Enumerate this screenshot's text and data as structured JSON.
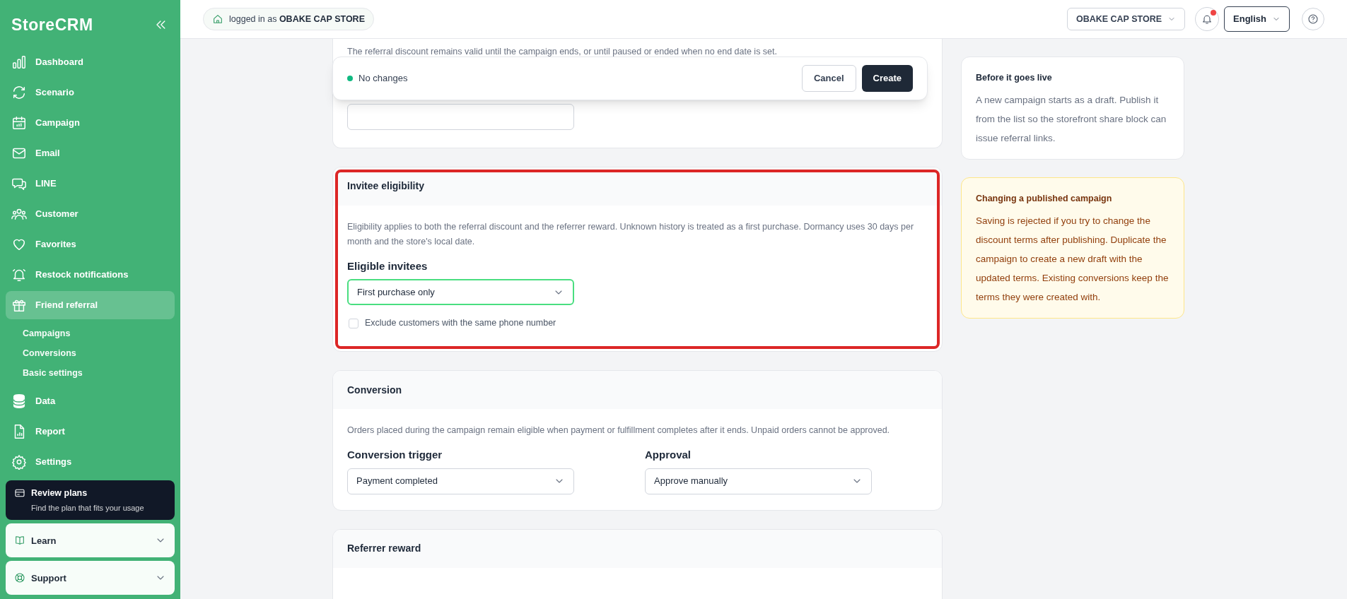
{
  "sidebar": {
    "brand": "StoreCRM",
    "items": [
      {
        "label": "Dashboard",
        "selected": false
      },
      {
        "label": "Scenario",
        "selected": false
      },
      {
        "label": "Campaign",
        "selected": false
      },
      {
        "label": "Email",
        "selected": false
      },
      {
        "label": "LINE",
        "selected": false
      },
      {
        "label": "Customer",
        "selected": false
      },
      {
        "label": "Favorites",
        "selected": false
      },
      {
        "label": "Restock notifications",
        "selected": false
      },
      {
        "label": "Friend referral",
        "selected": true,
        "children": [
          {
            "label": "Campaigns"
          },
          {
            "label": "Conversions"
          },
          {
            "label": "Basic settings"
          }
        ]
      },
      {
        "label": "Data",
        "selected": false
      },
      {
        "label": "Report",
        "selected": false
      },
      {
        "label": "Settings",
        "selected": false
      }
    ],
    "plan_card": {
      "title": "Review plans",
      "subtitle": "Find the plan that fits your usage"
    },
    "panels": [
      {
        "label": "Learn"
      },
      {
        "label": "Support"
      }
    ]
  },
  "topbar": {
    "login_prefix": "logged in as",
    "store_name": "OBAKE CAP STORE",
    "store_select": "OBAKE CAP STORE",
    "notification_unread": true,
    "language": "English"
  },
  "save_bar": {
    "status": "No changes",
    "buttons": [
      {
        "label": "Cancel",
        "kind": "secondary"
      },
      {
        "label": "Create",
        "kind": "primary"
      }
    ]
  },
  "main": {
    "top_card": {
      "note": "The referral discount remains valid until the campaign ends, or until paused or ended when no end date is set."
    },
    "sections": [
      {
        "title": "Invitee eligibility",
        "highlighted": true,
        "description": "Eligibility applies to both the referral discount and the referrer reward. Unknown history is treated as a first purchase. Dormancy uses 30 days per month and the store's local date.",
        "fields": [
          {
            "label": "Eligible invitees",
            "value": "First purchase only",
            "focused": true
          }
        ],
        "checkbox": {
          "label": "Exclude customers with the same phone number",
          "checked": false
        }
      },
      {
        "title": "Conversion",
        "highlighted": false,
        "description": "Orders placed during the campaign remain eligible when payment or fulfillment completes after it ends. Unpaid orders cannot be approved.",
        "fields": [
          {
            "label": "Conversion trigger",
            "value": "Payment completed",
            "focused": false
          },
          {
            "label": "Approval",
            "value": "Approve manually",
            "focused": false
          }
        ]
      },
      {
        "title": "Referrer reward",
        "highlighted": false
      }
    ]
  },
  "aside": [
    {
      "kind": "info",
      "title": "Before it goes live",
      "text": "A new campaign starts as a draft. Publish it from the list so the storefront share block can issue referral links."
    },
    {
      "kind": "warning",
      "title": "Changing a published campaign",
      "text": "Saving is rejected if you try to change the discount terms after publishing. Duplicate the campaign to create a new draft with the updated terms. Existing conversions keep the terms they were created with."
    }
  ]
}
